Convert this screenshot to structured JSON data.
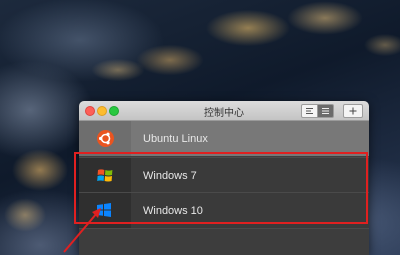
{
  "window": {
    "title": "控制中心",
    "toolbar": {
      "view_toggle_a_icon": "list-detail-icon",
      "view_toggle_b_icon": "list-compact-icon",
      "add_label": "+"
    }
  },
  "vms": [
    {
      "name": "Ubuntu Linux",
      "icon": "ubuntu-logo-icon",
      "selected": true
    },
    {
      "name": "Windows 7",
      "icon": "windows7-logo-icon",
      "selected": false
    },
    {
      "name": "Windows 10",
      "icon": "windows10-logo-icon",
      "selected": false
    }
  ],
  "annotation": {
    "highlight_color": "#e02020",
    "arrow_color": "#e02020"
  },
  "colors": {
    "titlebar": "#d0d0d0",
    "selected_row": "#787878",
    "row": "#3a3a3a",
    "ubuntu_orange": "#e95420"
  }
}
